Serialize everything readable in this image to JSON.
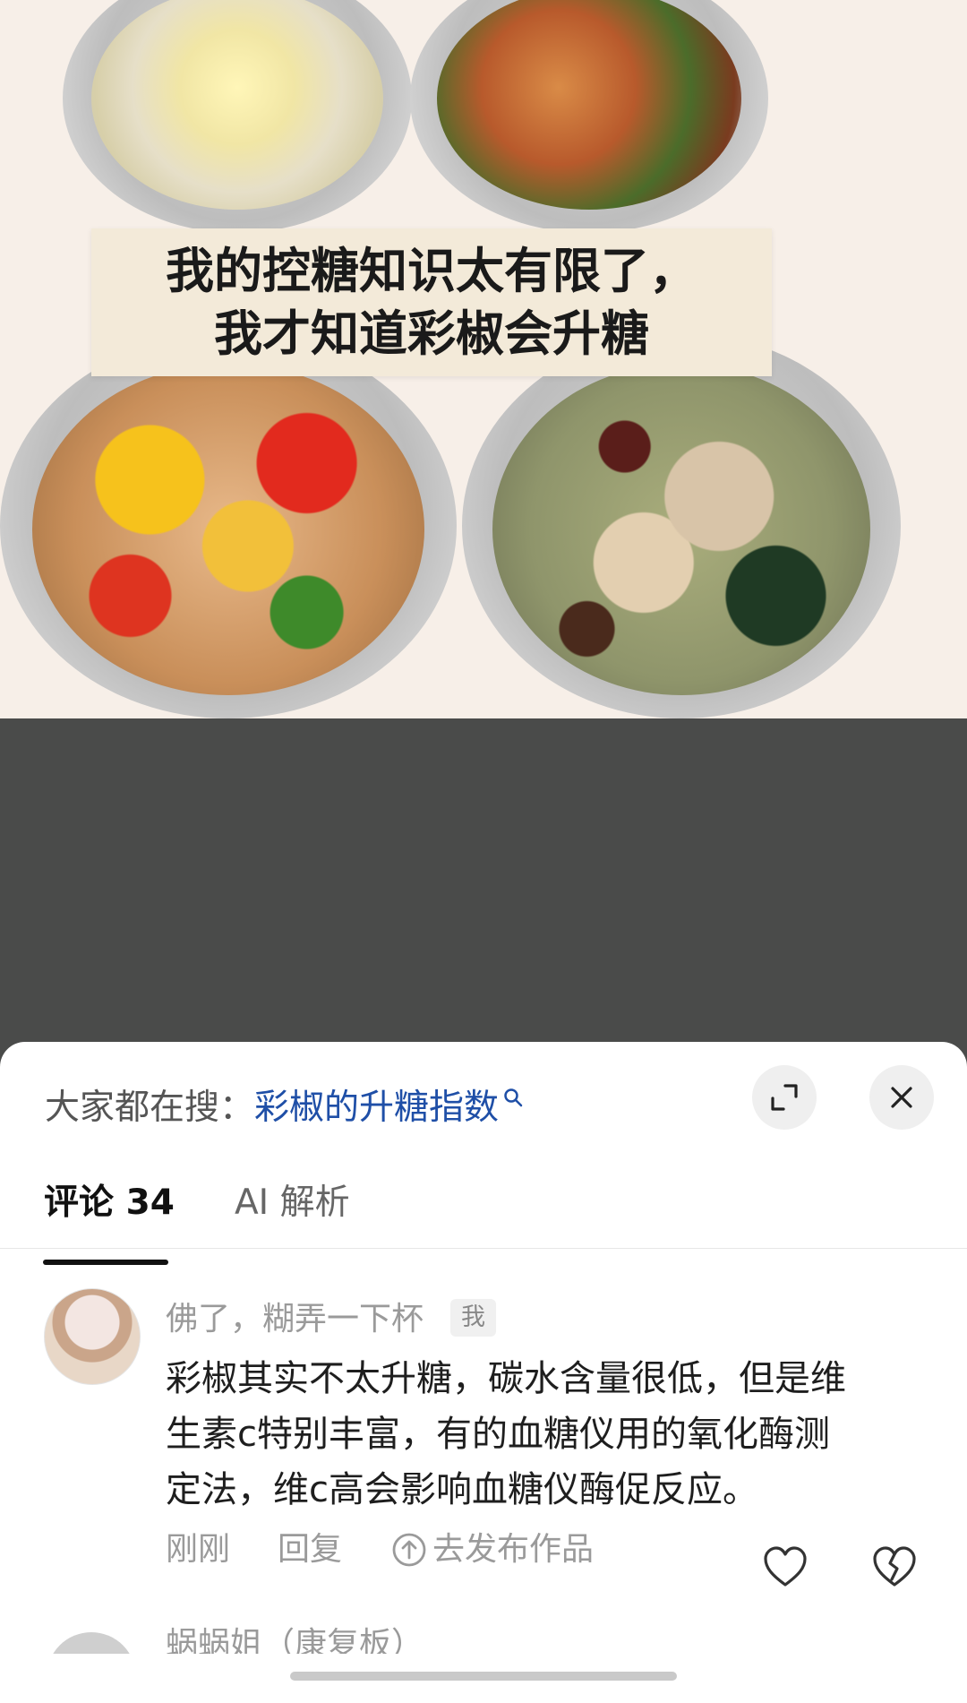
{
  "photo": {
    "caption_line1": "我的控糖知识太有限了，",
    "caption_line2": "我才知道彩椒会升糖"
  },
  "sheet": {
    "hot_search_label": "大家都在搜：",
    "hot_search_term": "彩椒的升糖指数",
    "tabs": [
      {
        "label": "评论 34",
        "active": true
      },
      {
        "label": "AI 解析",
        "active": false
      }
    ]
  },
  "comments": [
    {
      "username": "佛了，糊弄一下杯",
      "badge": "我",
      "text_lines": [
        "彩椒其实不太升糖，碳水含量很低，但是维",
        "生素c特别丰富，有的血糖仪用的氧化酶测",
        "定法，维c高会影响血糖仪酶促反应。"
      ],
      "time": "刚刚",
      "reply_label": "回复",
      "publish_label": "去发布作品"
    }
  ],
  "next_comment": {
    "username": "蜗蜗姐（康复板）"
  },
  "colors": {
    "link_blue": "#1f4fa7",
    "dim_overlay": "#4a4b4a"
  }
}
